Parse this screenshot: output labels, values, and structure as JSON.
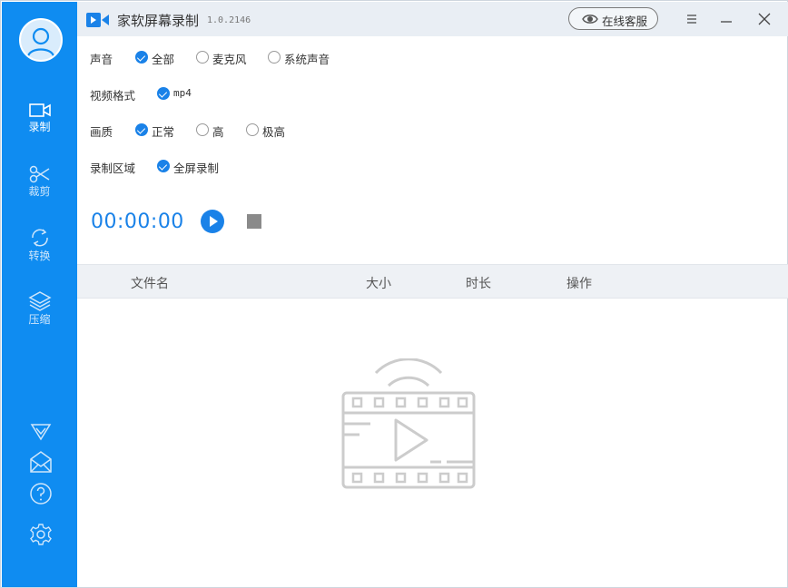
{
  "app": {
    "title": "家软屏幕录制",
    "version": "1.0.2146",
    "service_label": "在线客服",
    "accent_color": "#0f8cf1"
  },
  "sidebar": {
    "items": [
      {
        "label": "录制",
        "icon": "video-camera-icon",
        "active": true
      },
      {
        "label": "裁剪",
        "icon": "scissors-icon",
        "active": false
      },
      {
        "label": "转换",
        "icon": "convert-arrows-icon",
        "active": false
      },
      {
        "label": "压缩",
        "icon": "layers-icon",
        "active": false
      }
    ],
    "bottom_icons": [
      "vip-diamond-icon",
      "mail-icon",
      "help-icon",
      "settings-icon"
    ]
  },
  "settings": {
    "audio": {
      "label": "声音",
      "options": [
        "全部",
        "麦克风",
        "系统声音"
      ],
      "selected": "全部"
    },
    "format": {
      "label": "视频格式",
      "options": [
        "mp4"
      ],
      "selected": "mp4"
    },
    "quality": {
      "label": "画质",
      "options": [
        "正常",
        "高",
        "极高"
      ],
      "selected": "正常"
    },
    "area": {
      "label": "录制区域",
      "options": [
        "全屏录制"
      ],
      "selected": "全屏录制"
    }
  },
  "recorder": {
    "timer": "00:00:00"
  },
  "table": {
    "columns": [
      "文件名",
      "大小",
      "时长",
      "操作"
    ],
    "rows": []
  }
}
